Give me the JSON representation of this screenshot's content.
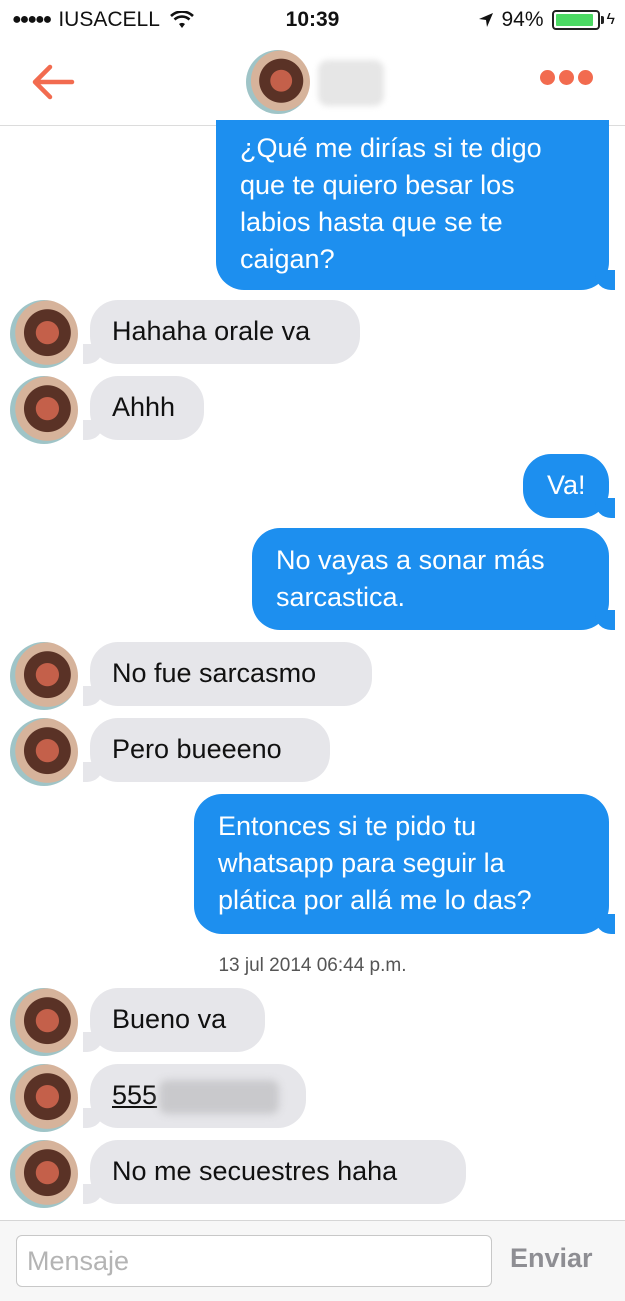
{
  "status_bar": {
    "signal": "●●●●●",
    "carrier": "IUSACELL",
    "time": "10:39",
    "battery_percent": "94%",
    "battery_level": 0.94,
    "bolt": "ϟ"
  },
  "nav": {
    "back_icon": "arrow-left-icon",
    "more_icon": "more-dots-icon",
    "accent_color": "#f26b4f"
  },
  "colors": {
    "outgoing": "#1d8fef",
    "incoming": "#e6e6ea"
  },
  "messages": [
    {
      "direction": "outgoing",
      "lines": [
        "¿Qué me dirías si te digo",
        "que te quiero besar los",
        "labios hasta que se te",
        "caigan?"
      ]
    },
    {
      "direction": "incoming",
      "text": "Hahaha orale va"
    },
    {
      "direction": "incoming",
      "text": "Ahhh"
    },
    {
      "direction": "outgoing",
      "text": "Va!"
    },
    {
      "direction": "outgoing",
      "lines": [
        "No vayas a sonar más",
        "sarcastica."
      ]
    },
    {
      "direction": "incoming",
      "text": "No fue sarcasmo"
    },
    {
      "direction": "incoming",
      "text": "Pero bueeeno"
    },
    {
      "direction": "outgoing",
      "lines": [
        "Entonces si te pido tu",
        "whatsapp  para seguir la",
        "plática por allá me lo das?"
      ]
    },
    {
      "direction": "incoming",
      "text": "Bueno va"
    },
    {
      "direction": "incoming",
      "text": "555"
    },
    {
      "direction": "incoming",
      "text": "No me secuestres haha"
    }
  ],
  "timestamp": "13 jul 2014 06:44 p.m.",
  "compose": {
    "placeholder": "Mensaje",
    "send_label": "Enviar"
  }
}
